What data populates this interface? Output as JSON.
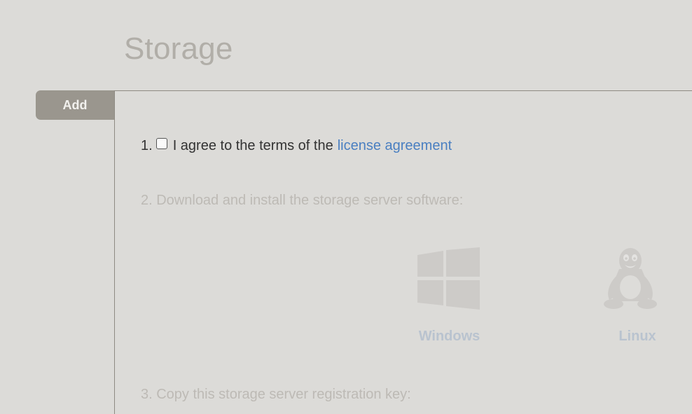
{
  "header": {
    "title": "Storage"
  },
  "tabs": [
    {
      "label": "Add",
      "active": true
    }
  ],
  "steps": {
    "agree": {
      "number": "1.",
      "text": "I agree to the terms of the",
      "link_text": "license agreement",
      "checked": false
    },
    "download": {
      "text": "2. Download and install the storage server software:"
    },
    "register": {
      "text": "3. Copy this storage server registration key:"
    }
  },
  "downloads": {
    "windows": {
      "label": "Windows",
      "icon": "windows-logo-icon"
    },
    "linux": {
      "label": "Linux",
      "icon": "tux-penguin-icon"
    }
  },
  "colors": {
    "background": "#dcdbd8",
    "tab_active": "#9a968e",
    "link": "#4a7fc1",
    "disabled_text": "#bdbab5",
    "disabled_os_label": "#b9c3cf",
    "title": "#b1aea8"
  }
}
